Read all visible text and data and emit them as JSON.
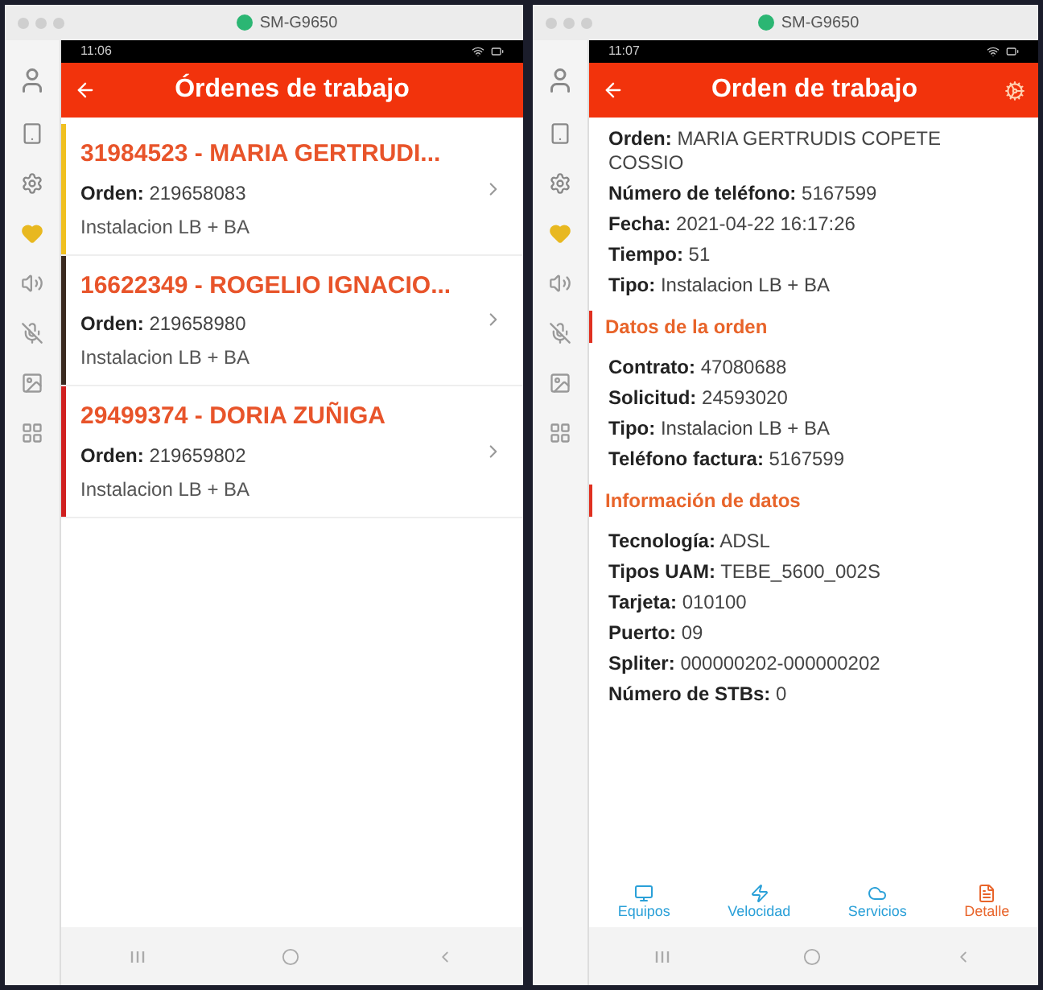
{
  "left_window": {
    "title": "SM-G9650",
    "status_time": "11:06",
    "header": "Órdenes de trabajo",
    "orders": [
      {
        "title": "31984523 - MARIA GERTRUDI...",
        "order_label": "Orden:",
        "order_value": "219658083",
        "type": "Instalacion LB + BA",
        "color": "#f0c020"
      },
      {
        "title": "16622349 - ROGELIO IGNACIO...",
        "order_label": "Orden:",
        "order_value": "219658980",
        "type": "Instalacion LB + BA",
        "color": "#3a2a20"
      },
      {
        "title": "29499374 - DORIA ZUÑIGA",
        "order_label": "Orden:",
        "order_value": "219659802",
        "type": "Instalacion LB + BA",
        "color": "#d02020"
      }
    ]
  },
  "right_window": {
    "title": "SM-G9650",
    "status_time": "11:07",
    "header": "Orden de trabajo",
    "rows": [
      {
        "kind": "field",
        "label": "Orden:",
        "value": "MARIA GERTRUDIS COPETE COSSIO"
      },
      {
        "kind": "field",
        "label": "Número de teléfono:",
        "value": "5167599"
      },
      {
        "kind": "field",
        "label": "Fecha:",
        "value": "2021-04-22 16:17:26"
      },
      {
        "kind": "field",
        "label": "Tiempo:",
        "value": "51"
      },
      {
        "kind": "field",
        "label": "Tipo:",
        "value": "Instalacion LB + BA"
      },
      {
        "kind": "section",
        "label": "Datos de la orden"
      },
      {
        "kind": "field",
        "label": "Contrato:",
        "value": "47080688"
      },
      {
        "kind": "field",
        "label": "Solicitud:",
        "value": "24593020"
      },
      {
        "kind": "field",
        "label": "Tipo:",
        "value": "Instalacion LB + BA"
      },
      {
        "kind": "field",
        "label": "Teléfono factura:",
        "value": "5167599"
      },
      {
        "kind": "section",
        "label": "Información de datos"
      },
      {
        "kind": "field",
        "label": "Tecnología:",
        "value": "ADSL"
      },
      {
        "kind": "field",
        "label": "Tipos UAM:",
        "value": "TEBE_5600_002S"
      },
      {
        "kind": "field",
        "label": "Tarjeta:",
        "value": "010100"
      },
      {
        "kind": "field",
        "label": "Puerto:",
        "value": "09"
      },
      {
        "kind": "field",
        "label": "Spliter:",
        "value": "000000202-000000202"
      },
      {
        "kind": "field",
        "label": "Número de STBs:",
        "value": "0"
      }
    ],
    "tabs": [
      {
        "kind": "devices",
        "label": "Equipos",
        "selected": false
      },
      {
        "kind": "speed",
        "label": "Velocidad",
        "selected": false
      },
      {
        "kind": "services",
        "label": "Servicios",
        "selected": false
      },
      {
        "kind": "detail",
        "label": "Detalle",
        "selected": true
      }
    ]
  }
}
